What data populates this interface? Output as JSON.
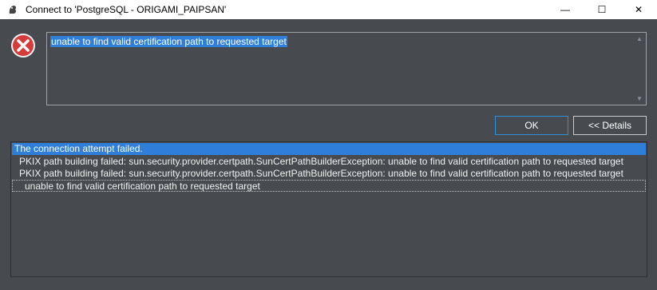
{
  "window": {
    "title": "Connect to 'PostgreSQL - ORIGAMI_PAIPSAN'",
    "controls": {
      "minimize": "—",
      "maximize": "☐",
      "close": "✕"
    }
  },
  "message": {
    "text": "unable to find valid certification path to requested target",
    "icon": "error-icon"
  },
  "buttons": {
    "ok": "OK",
    "details": "<< Details"
  },
  "details": {
    "rows": [
      "The connection attempt failed.",
      "PKIX path building failed: sun.security.provider.certpath.SunCertPathBuilderException: unable to find valid certification path to requested target",
      "PKIX path building failed: sun.security.provider.certpath.SunCertPathBuilderException: unable to find valid certification path to requested target",
      "unable to find valid certification path to requested target"
    ]
  },
  "colors": {
    "background": "#474b50",
    "selection": "#2f7ed8",
    "error_red": "#d63a3a"
  }
}
